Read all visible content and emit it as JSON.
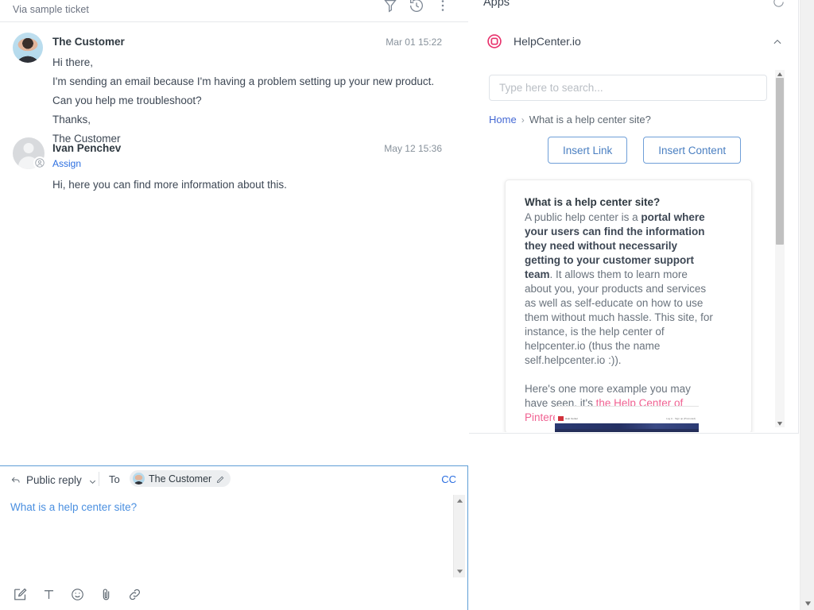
{
  "ticket": {
    "via_text": "Via sample ticket",
    "header_icons": [
      {
        "name": "ticket-filter-icon",
        "label": "Filter"
      },
      {
        "name": "history-clock-icon",
        "label": "Events"
      },
      {
        "name": "more-options-icon",
        "label": "More"
      }
    ],
    "messages": [
      {
        "author": "The Customer",
        "timestamp": "Mar 01 15:22",
        "avatar_type": "photo",
        "body_lines": [
          "Hi there,",
          "I'm sending an email because I'm having a problem setting up your new product. Can you help me troubleshoot?",
          "Thanks,",
          "The Customer"
        ]
      },
      {
        "author": "Ivan Penchev",
        "timestamp": "May 12 15:36",
        "avatar_type": "generic",
        "assign_label": "Assign",
        "body_lines": [
          "Hi, here you can find more information about this."
        ]
      }
    ]
  },
  "compose": {
    "reply_type": "Public reply",
    "to_label": "To",
    "recipient": "The Customer",
    "cc_label": "CC",
    "editor_text": "What is a help center site?",
    "toolbar_icons": [
      {
        "name": "compose-macro-icon",
        "label": "Apply macro"
      },
      {
        "name": "text-format-icon",
        "label": "Text formatting"
      },
      {
        "name": "emoji-icon",
        "label": "Emoji"
      },
      {
        "name": "attachment-icon",
        "label": "Attach file"
      },
      {
        "name": "link-icon",
        "label": "Insert link"
      }
    ]
  },
  "apps": {
    "title": "Apps",
    "refresh_icon": "refresh-icon",
    "app": {
      "name": "HelpCenter.io",
      "logo_icon": "lifebuoy-icon",
      "logo_color": "#e8336d",
      "collapse_icon": "chevron-up-icon",
      "search_placeholder": "Type here to search...",
      "search_value": "",
      "breadcrumb": {
        "home": "Home",
        "separator": "›",
        "current": "What is a help center site?"
      },
      "buttons": [
        {
          "label": "Insert Link",
          "name": "insert-link-button"
        },
        {
          "label": "Insert Content",
          "name": "insert-content-button"
        }
      ],
      "article": {
        "title": "What is a help center site?",
        "paragraph1_pre": "A public help center is a ",
        "paragraph1_bold": "portal where your users can find the information they need without necessarily getting to your customer support team",
        "paragraph1_post": ". It allows them to learn more about you, your products and services as well as self-educate on how to use them without much hassle. This site, for instance, is the help center of helpcenter.io (thus the name self.helpcenter.io :)).",
        "paragraph2_pre": "Here's one more example you may have seen, it's ",
        "paragraph2_link": "the Help Center of Pinterest:",
        "thumbnail_alt": "Pinterest Help Center screenshot",
        "thumbnail_brand": "Help Center",
        "thumbnail_right": "Log in  ·  Sign up (Promoted)"
      }
    }
  },
  "colors": {
    "link": "#2b6ee0",
    "accent_pink": "#e8336d",
    "button_border": "#6f9fd8",
    "compose_border": "#5e9ed6"
  }
}
